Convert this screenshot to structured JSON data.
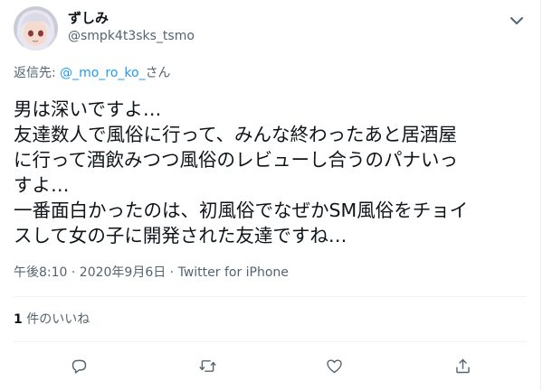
{
  "tweet": {
    "display_name": "ずしみ",
    "handle": "@smpk4t3sks_tsmo",
    "reply_prefix": "返信先:",
    "reply_mention": "@_mo_ro_ko_",
    "reply_suffix": "さん",
    "lines": [
      "男は深いですよ…",
      "友達数人で風俗に行って、みんな終わったあと居酒屋",
      "に行って酒飲みつつ風俗のレビューし合うのパナいっ",
      "すよ…",
      "一番面白かったのは、初風俗でなぜかSM風俗をチョイ",
      "スして女の子に開発された友達ですね…"
    ],
    "timestamp": "午後8:10 · 2020年9月6日",
    "source_sep": " · ",
    "source": "Twitter for iPhone",
    "like_count": "1",
    "like_label": "件のいいね"
  },
  "icons": {
    "more": "chevron-down-icon",
    "reply": "reply-icon",
    "retweet": "retweet-icon",
    "like": "heart-icon",
    "share": "share-icon"
  },
  "colors": {
    "text": "#0f1419",
    "secondary": "#536471",
    "link": "#1d9bf0",
    "border": "#eff3f4"
  }
}
